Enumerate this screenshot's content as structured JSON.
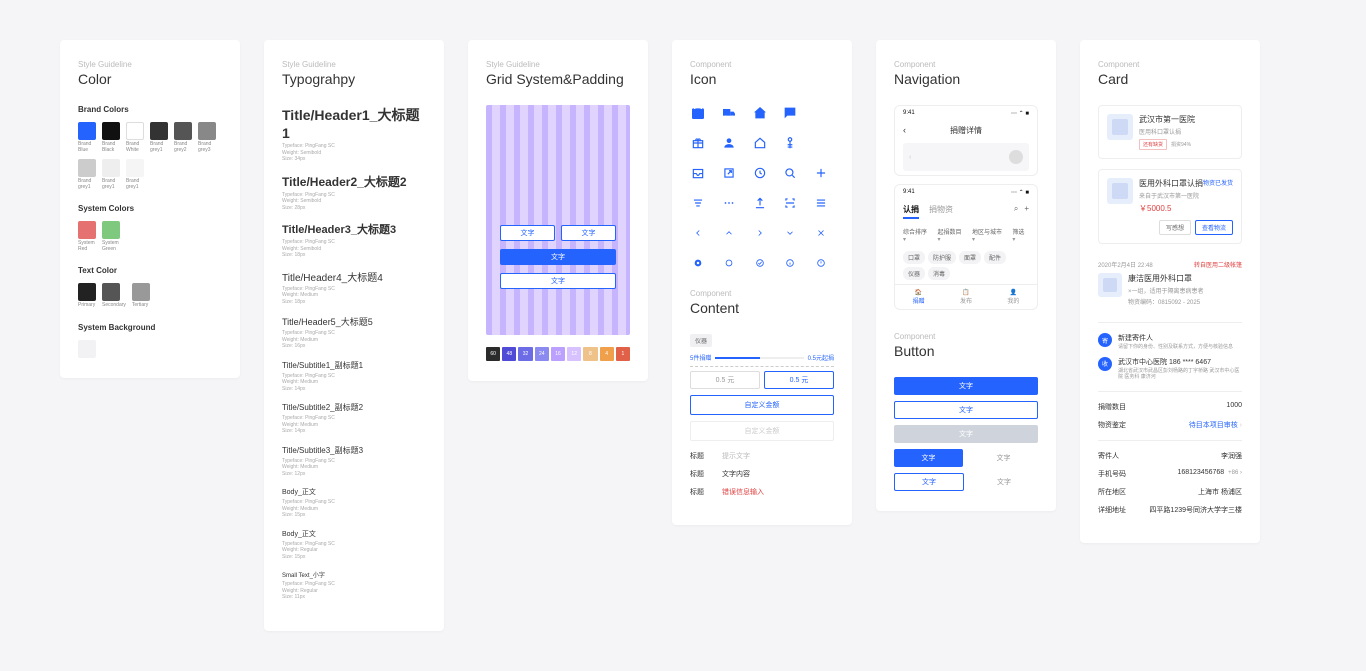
{
  "color": {
    "eyebrow": "Style Guideline",
    "title": "Color",
    "brand_section": "Brand Colors",
    "brand": [
      {
        "label": "Brand\nBlue",
        "hex": "#2563ff"
      },
      {
        "label": "Brand\nBlack",
        "hex": "#111111"
      },
      {
        "label": "Brand\nWhite",
        "hex": "#ffffff",
        "border": true
      },
      {
        "label": "Brand\ngrey1",
        "hex": "#333333"
      },
      {
        "label": "Brand\ngrey2",
        "hex": "#555555"
      },
      {
        "label": "Brand\ngrey3",
        "hex": "#888888"
      },
      {
        "label": "Brand\ngrey1",
        "hex": "#cccccc"
      },
      {
        "label": "Brand\ngrey1",
        "hex": "#eeeeee"
      },
      {
        "label": "Brand\ngrey1",
        "hex": "#f5f5f5"
      }
    ],
    "system_section": "System Colors",
    "system": [
      {
        "label": "System\nRed",
        "hex": "#e57171"
      },
      {
        "label": "System\nGreen",
        "hex": "#7fc97f"
      }
    ],
    "text_section": "Text Color",
    "text": [
      {
        "label": "Primary",
        "hex": "#222222"
      },
      {
        "label": "Secondary",
        "hex": "#555555"
      },
      {
        "label": "Tertiary",
        "hex": "#999999"
      }
    ],
    "bg_section": "System Background",
    "bg": {
      "hex": "#f2f2f4"
    }
  },
  "typo": {
    "eyebrow": "Style Guideline",
    "title": "Typograhpy",
    "items": [
      {
        "cls": "typo-h1",
        "text": "Title/Header1_大标题1",
        "meta": "Typeface: PingFang SC\nWeight: Semibold\nSize: 34px"
      },
      {
        "cls": "typo-h2",
        "text": "Title/Header2_大标题2",
        "meta": "Typeface: PingFang SC\nWeight: Semibold\nSize: 28px"
      },
      {
        "cls": "typo-h3",
        "text": "Title/Header3_大标题3",
        "meta": "Typeface: PingFang SC\nWeight: Semibold\nSize: 18px"
      },
      {
        "cls": "typo-h4",
        "text": "Title/Header4_大标题4",
        "meta": "Typeface: PingFang SC\nWeight: Medium\nSize: 18px"
      },
      {
        "cls": "typo-h5",
        "text": "Title/Header5_大标题5",
        "meta": "Typeface: PingFang SC\nWeight: Medium\nSize: 16px"
      },
      {
        "cls": "typo-sub",
        "text": "Title/Subtitle1_副标题1",
        "meta": "Typeface: PingFang SC\nWeight: Medium\nSize: 14px"
      },
      {
        "cls": "typo-sub",
        "text": "Title/Subtitle2_副标题2",
        "meta": "Typeface: PingFang SC\nWeight: Medium\nSize: 14px"
      },
      {
        "cls": "typo-sub",
        "text": "Title/Subtitle3_副标题3",
        "meta": "Typeface: PingFang SC\nWeight: Medium\nSize: 12px"
      },
      {
        "cls": "typo-body",
        "text": "Body_正文",
        "meta": "Typeface: PingFang SC\nWeight: Medium\nSize: 15px"
      },
      {
        "cls": "typo-body",
        "text": "Body_正文",
        "meta": "Typeface: PingFang SC\nWeight: Regular\nSize: 15px"
      },
      {
        "cls": "typo-small",
        "text": "Small Text_小字",
        "meta": "Typeface: PingFang SC\nWeight: Regular\nSize: 11px"
      }
    ]
  },
  "grid": {
    "eyebrow": "Style Guideline",
    "title": "Grid System&Padding",
    "btn_text": "文字",
    "grad": [
      {
        "v": "60",
        "c": "#2b2b2b"
      },
      {
        "v": "48",
        "c": "#4f4bd6"
      },
      {
        "v": "32",
        "c": "#6c6ce6"
      },
      {
        "v": "24",
        "c": "#8a8af0"
      },
      {
        "v": "16",
        "c": "#bba0ff"
      },
      {
        "v": "12",
        "c": "#d7c2ff"
      },
      {
        "v": "8",
        "c": "#efc28a"
      },
      {
        "v": "4",
        "c": "#f0a04a"
      },
      {
        "v": "1",
        "c": "#e06048"
      }
    ]
  },
  "icon": {
    "eyebrow": "Component",
    "title": "Icon"
  },
  "content": {
    "eyebrow": "Component",
    "title": "Content",
    "tag": "仪器",
    "prog_left": "5件捐赠",
    "prog_right": "0.5元起捐",
    "amount_placeholder": "0.5  元",
    "amount_active": "0.5  元",
    "custom": "自定义金额",
    "custom_ghost": "自定义金额",
    "rows": [
      {
        "label": "标题",
        "hint": "提示文字",
        "type": "hint"
      },
      {
        "label": "标题",
        "hint": "文字内容",
        "type": "val"
      },
      {
        "label": "标题",
        "hint": "错误信息输入",
        "type": "err"
      }
    ]
  },
  "nav": {
    "eyebrow": "Component",
    "title": "Navigation",
    "time": "9:41",
    "signals": "⋯ ⌃ ■",
    "head": "捐赠详情",
    "tabs": [
      "认捐",
      "捐物资"
    ],
    "filters": [
      "综合排序",
      "起捐数目",
      "地区与城市",
      "筛选"
    ],
    "chips": [
      "口罩",
      "防护服",
      "面罩",
      "配件",
      "仪器",
      "消毒"
    ],
    "tabbar": [
      {
        "icon": "🏠",
        "label": "捐赠"
      },
      {
        "icon": "📋",
        "label": "发布"
      },
      {
        "icon": "👤",
        "label": "我的"
      }
    ]
  },
  "button": {
    "eyebrow": "Component",
    "title": "Button",
    "text": "文字"
  },
  "card": {
    "eyebrow": "Component",
    "title": "Card",
    "c1": {
      "title": "武汉市第一医院",
      "sub": "医用科口罩认捐",
      "tag": "还有缺货",
      "plain": "捐资94%"
    },
    "c2": {
      "title": "医用外科口罩认捐",
      "sub": "来自于武汉市第一医院",
      "status": "物资已发货",
      "price": "￥5000.5",
      "a1": "写感想",
      "a2": "查看物流"
    },
    "post": {
      "time": "2020年2月4日 22:48",
      "right": "转自医用二级帐篷",
      "title": "康洁医用外科口罩",
      "d1": "×一组，适用于隔离患病患者",
      "d2": "物资编码：0815092 - 2025"
    },
    "info": [
      {
        "badge": "寄",
        "title": "新建寄件人",
        "desc": "请留下你的身份、性别及联系方式，方便与核验信息"
      },
      {
        "badge": "收",
        "title": "武汉市中心医院 186 **** 6467",
        "desc": "湖北省武汉市武昌区彭刘杨路的丁字桥路 武汉市中心医院 医务科 康济河"
      }
    ],
    "kv": [
      {
        "k": "捐赠数目",
        "v": "1000"
      },
      {
        "k": "物资鉴定",
        "v": "待目本项目审核",
        "link": true
      }
    ],
    "kv2": [
      {
        "k": "寄件人",
        "v": "李润强"
      },
      {
        "k": "手机号码",
        "v": "168123456768",
        "suffix": "+86"
      },
      {
        "k": "所在地区",
        "v": "上海市 杨浦区"
      },
      {
        "k": "详细地址",
        "v": "四平路1239号同济大学字三楼"
      }
    ]
  }
}
